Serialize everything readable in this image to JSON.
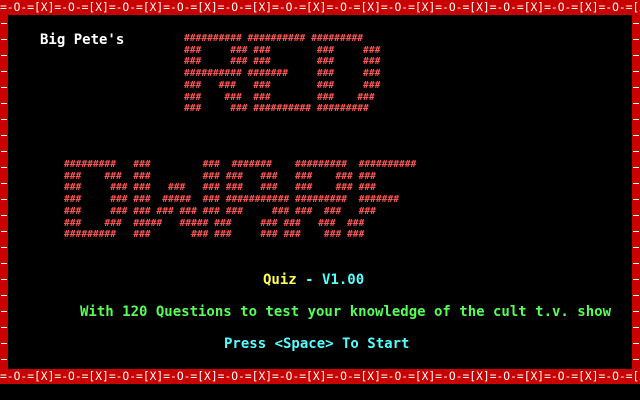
{
  "title_screen": {
    "byline": "Big Pete's",
    "title_word_1": "RED",
    "title_word_2": "DWARF",
    "quiz_label": "Quiz",
    "version": "- V1.00",
    "tagline": "With 120 Questions to test your knowledge of the cult t.v. show",
    "start_prompt": "Press <Space> To Start"
  },
  "border": {
    "pattern": "=-O-=[X]",
    "frame_color": "#c80000",
    "pattern_color": "#ffffff"
  },
  "ascii_art": {
    "red": [
      "########## ########## #########",
      "###     ### ###        ###     ###",
      "###     ### ###        ###     ###",
      "########## #######     ###     ###",
      "###   ###   ###        ###     ###",
      "###    ###  ###        ###    ###",
      "###     ### ########## #########"
    ],
    "dwarf": [
      "#########   ###         ###  #######    #########  ##########",
      "###    ###  ###         ### ###   ###   ###    ### ###",
      "###     ### ###   ###   ### ###   ###   ###    ### ###",
      "###     ### ###  #####  ### ########### #########  #######",
      "###     ### ### ### ### ### ###     ### ###  ###   ###",
      "###    ###  #####   ##### ###     ### ###   ###  ###",
      "#########   ###       ### ###     ### ###    ### ###"
    ],
    "color": "#ff5555"
  },
  "colors": {
    "byline": "#ffffff",
    "quiz": "#ffff55",
    "version": "#55ffff",
    "tagline": "#55ff55",
    "start": "#55ffff"
  }
}
